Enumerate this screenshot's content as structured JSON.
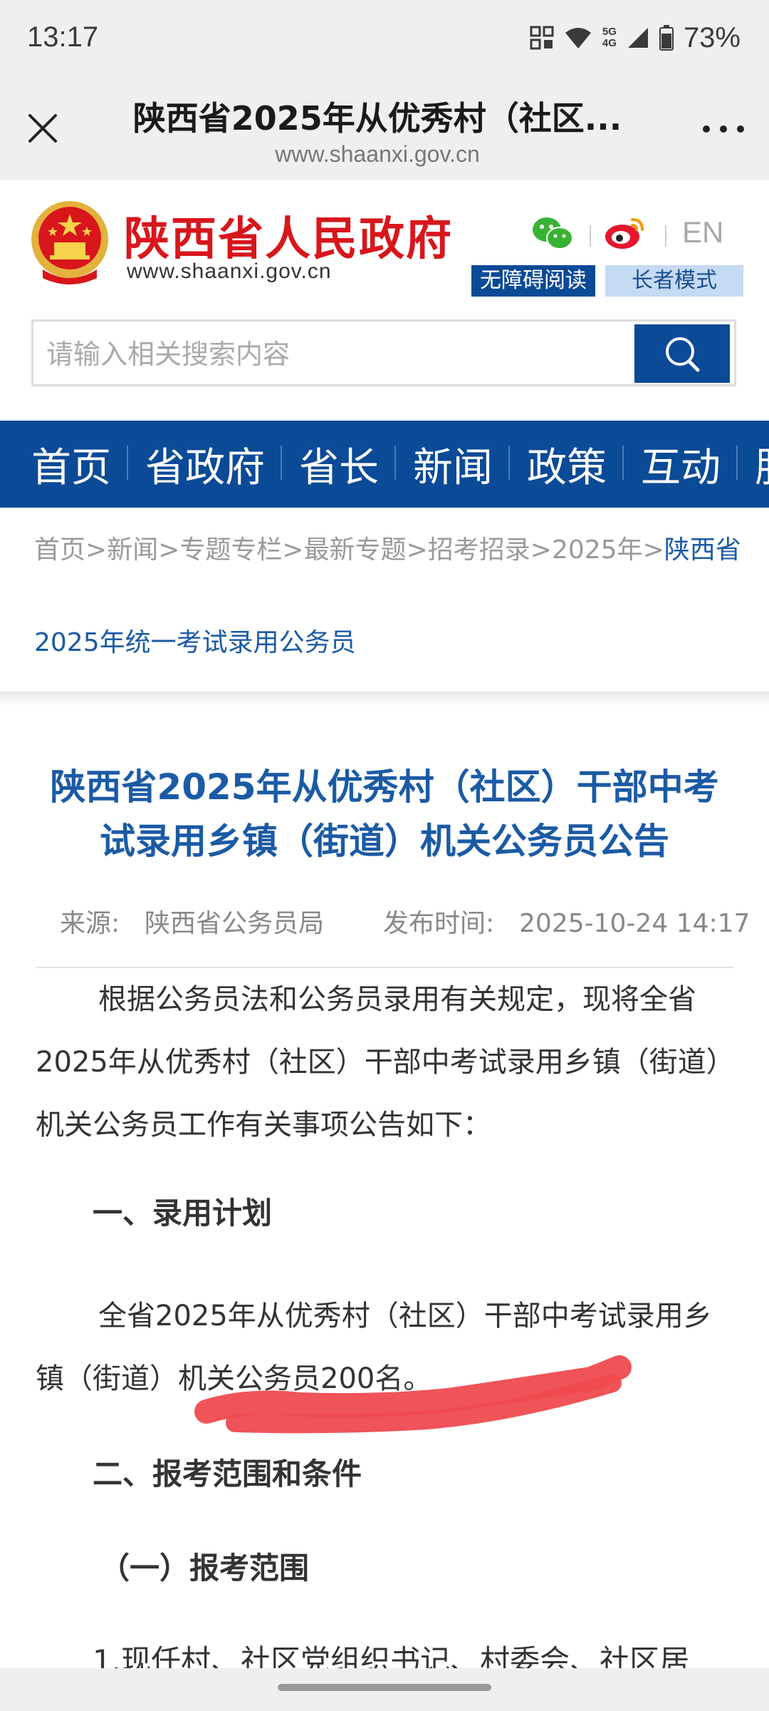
{
  "status_bar": {
    "time": "13:17",
    "network_label_top": "5G",
    "network_label_bottom": "4G",
    "battery_percent": "73%"
  },
  "browser": {
    "title": "陕西省2025年从优秀村（社区...",
    "url": "www.shaanxi.gov.cn"
  },
  "site": {
    "name": "陕西省人民政府",
    "url": "www.shaanxi.gov.cn",
    "lang_en": "EN",
    "accessibility_label": "无障碍阅读",
    "elder_mode_label": "长者模式",
    "search_placeholder": "请输入相关搜索内容",
    "brand_color": "#0b4a96",
    "name_color": "#d8161c"
  },
  "nav": {
    "items": [
      "首页",
      "省政府",
      "省长",
      "新闻",
      "政策",
      "互动",
      "服务"
    ]
  },
  "breadcrumb": {
    "path": [
      "首页",
      "新闻",
      "专题专栏",
      "最新专题",
      "招考招录",
      "2025年"
    ],
    "current_line1": "陕西省",
    "current_line2": "2025年统一考试录用公务员"
  },
  "article": {
    "title": "陕西省2025年从优秀村（社区）干部中考试录用乡镇（街道）机关公务员公告",
    "source_label": "来源:",
    "source": "陕西省公务员局",
    "published_label": "发布时间:",
    "published": "2025-10-24 14:17",
    "para1": "根据公务员法和公务员录用有关规定，现将全省2025年从优秀村（社区）干部中考试录用乡镇（街道）机关公务员工作有关事项公告如下：",
    "heading1": "一、录用计划",
    "para2": "全省2025年从优秀村（社区）干部中考试录用乡镇（街道）机关公务员200名。",
    "heading2": "二、报考范围和条件",
    "heading3": "（一）报考范围",
    "para3_partial": "1.现任村、社区党组织书记、村委会、社区居"
  }
}
